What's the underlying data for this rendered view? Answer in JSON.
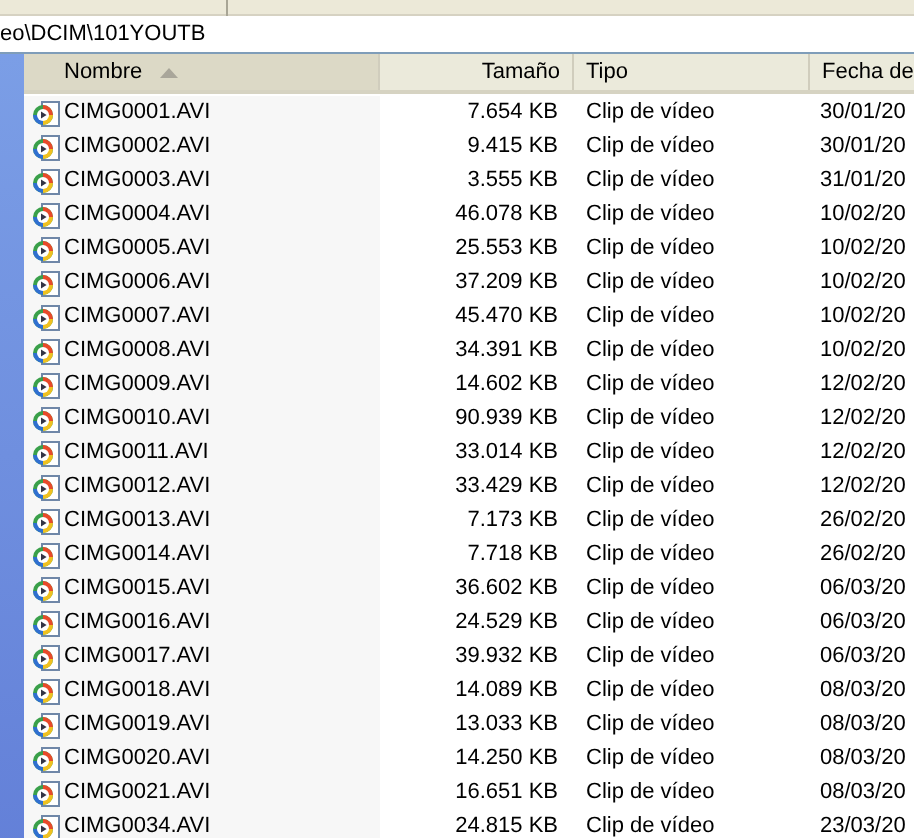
{
  "address_bar": {
    "path": "eo\\DCIM\\101YOUTB"
  },
  "table": {
    "columns": [
      {
        "label": "Nombre",
        "sorted": true
      },
      {
        "label": "Tamaño",
        "sorted": false
      },
      {
        "label": "Tipo",
        "sorted": false
      },
      {
        "label": "Fecha de",
        "sorted": false
      }
    ],
    "rows": [
      {
        "name": "CIMG0001.AVI",
        "size": "7.654 KB",
        "type": "Clip de vídeo",
        "date": "30/01/20"
      },
      {
        "name": "CIMG0002.AVI",
        "size": "9.415 KB",
        "type": "Clip de vídeo",
        "date": "30/01/20"
      },
      {
        "name": "CIMG0003.AVI",
        "size": "3.555 KB",
        "type": "Clip de vídeo",
        "date": "31/01/20"
      },
      {
        "name": "CIMG0004.AVI",
        "size": "46.078 KB",
        "type": "Clip de vídeo",
        "date": "10/02/20"
      },
      {
        "name": "CIMG0005.AVI",
        "size": "25.553 KB",
        "type": "Clip de vídeo",
        "date": "10/02/20"
      },
      {
        "name": "CIMG0006.AVI",
        "size": "37.209 KB",
        "type": "Clip de vídeo",
        "date": "10/02/20"
      },
      {
        "name": "CIMG0007.AVI",
        "size": "45.470 KB",
        "type": "Clip de vídeo",
        "date": "10/02/20"
      },
      {
        "name": "CIMG0008.AVI",
        "size": "34.391 KB",
        "type": "Clip de vídeo",
        "date": "10/02/20"
      },
      {
        "name": "CIMG0009.AVI",
        "size": "14.602 KB",
        "type": "Clip de vídeo",
        "date": "12/02/20"
      },
      {
        "name": "CIMG0010.AVI",
        "size": "90.939 KB",
        "type": "Clip de vídeo",
        "date": "12/02/20"
      },
      {
        "name": "CIMG0011.AVI",
        "size": "33.014 KB",
        "type": "Clip de vídeo",
        "date": "12/02/20"
      },
      {
        "name": "CIMG0012.AVI",
        "size": "33.429 KB",
        "type": "Clip de vídeo",
        "date": "12/02/20"
      },
      {
        "name": "CIMG0013.AVI",
        "size": "7.173 KB",
        "type": "Clip de vídeo",
        "date": "26/02/20"
      },
      {
        "name": "CIMG0014.AVI",
        "size": "7.718 KB",
        "type": "Clip de vídeo",
        "date": "26/02/20"
      },
      {
        "name": "CIMG0015.AVI",
        "size": "36.602 KB",
        "type": "Clip de vídeo",
        "date": "06/03/20"
      },
      {
        "name": "CIMG0016.AVI",
        "size": "24.529 KB",
        "type": "Clip de vídeo",
        "date": "06/03/20"
      },
      {
        "name": "CIMG0017.AVI",
        "size": "39.932 KB",
        "type": "Clip de vídeo",
        "date": "06/03/20"
      },
      {
        "name": "CIMG0018.AVI",
        "size": "14.089 KB",
        "type": "Clip de vídeo",
        "date": "08/03/20"
      },
      {
        "name": "CIMG0019.AVI",
        "size": "13.033 KB",
        "type": "Clip de vídeo",
        "date": "08/03/20"
      },
      {
        "name": "CIMG0020.AVI",
        "size": "14.250 KB",
        "type": "Clip de vídeo",
        "date": "08/03/20"
      },
      {
        "name": "CIMG0021.AVI",
        "size": "16.651 KB",
        "type": "Clip de vídeo",
        "date": "08/03/20"
      },
      {
        "name": "CIMG0034.AVI",
        "size": "24.815 KB",
        "type": "Clip de vídeo",
        "date": "23/03/20"
      }
    ]
  }
}
